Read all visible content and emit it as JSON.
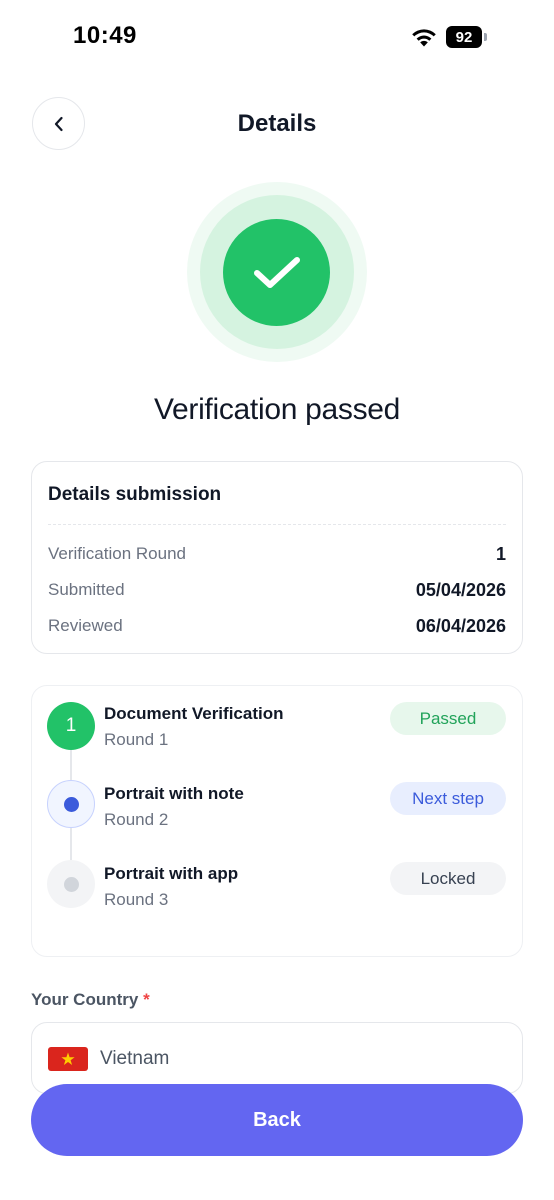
{
  "status_bar": {
    "time": "10:49",
    "battery_level": "92"
  },
  "header": {
    "title": "Details"
  },
  "result": {
    "heading": "Verification passed",
    "success_color": "#22c268"
  },
  "submission": {
    "title": "Details submission",
    "rows": [
      {
        "label": "Verification Round",
        "value": "1"
      },
      {
        "label": "Submitted",
        "value": "05/04/2026"
      },
      {
        "label": "Reviewed",
        "value": "06/04/2026"
      }
    ]
  },
  "steps": [
    {
      "marker": "1",
      "title": "Document Verification",
      "round": "Round 1",
      "status": "Passed",
      "state": "done"
    },
    {
      "marker": "",
      "title": "Portrait with note",
      "round": "Round 2",
      "status": "Next step",
      "state": "current"
    },
    {
      "marker": "",
      "title": "Portrait with app",
      "round": "Round 3",
      "status": "Locked",
      "state": "locked"
    }
  ],
  "country": {
    "label": "Your Country",
    "required_marker": "*",
    "value": "Vietnam",
    "flag_icon": "vietnam-flag-icon"
  },
  "actions": {
    "back_label": "Back",
    "accent_color": "#6366f1"
  }
}
